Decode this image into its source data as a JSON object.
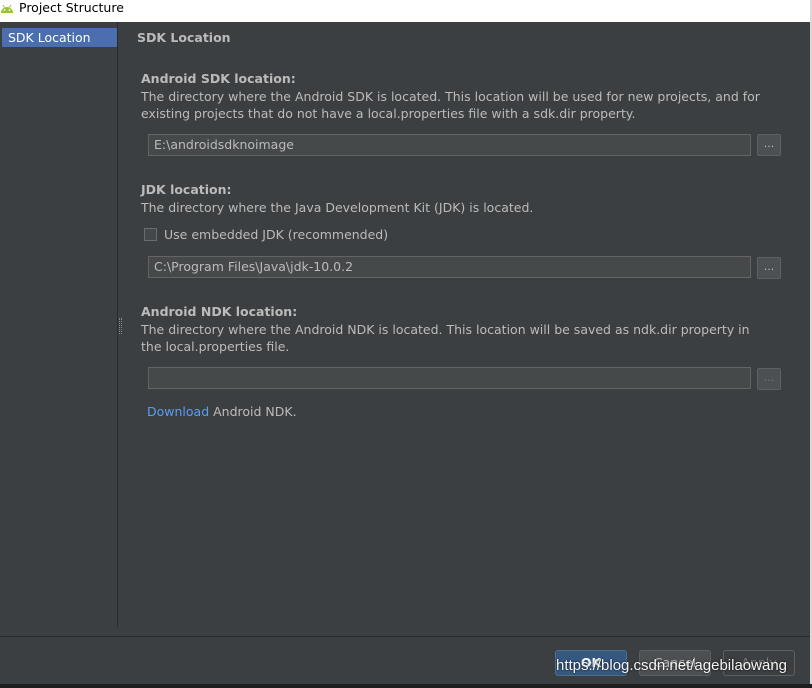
{
  "window": {
    "title": "Project Structure"
  },
  "sidebar": {
    "items": [
      {
        "label": "SDK Location"
      }
    ]
  },
  "main": {
    "page_title": "SDK Location",
    "android_sdk": {
      "heading": "Android SDK location:",
      "description": "The directory where the Android SDK is located. This location will be used for new projects, and for existing projects that do not have a local.properties file with a sdk.dir property.",
      "path": "E:\\androidsdknoimage",
      "browse_label": "..."
    },
    "jdk": {
      "heading": "JDK location:",
      "description": "The directory where the Java Development Kit (JDK) is located.",
      "checkbox_label": "Use embedded JDK (recommended)",
      "checkbox_checked": false,
      "path": "C:\\Program Files\\Java\\jdk-10.0.2",
      "browse_label": "..."
    },
    "ndk": {
      "heading": "Android NDK location:",
      "description": "The directory where the Android NDK is located. This location will be saved as ndk.dir property in the local.properties file.",
      "path": "",
      "browse_label": "...",
      "download_link": "Download",
      "download_suffix": "Android NDK."
    }
  },
  "footer": {
    "ok_label": "OK",
    "cancel_label": "Cancel",
    "apply_label": "Apply"
  },
  "watermark": "https://blog.csdn.net/agebilaowang",
  "colors": {
    "background": "#3c3f41",
    "selection": "#4b6eaf",
    "link": "#589df6",
    "primary_button": "#365880"
  }
}
